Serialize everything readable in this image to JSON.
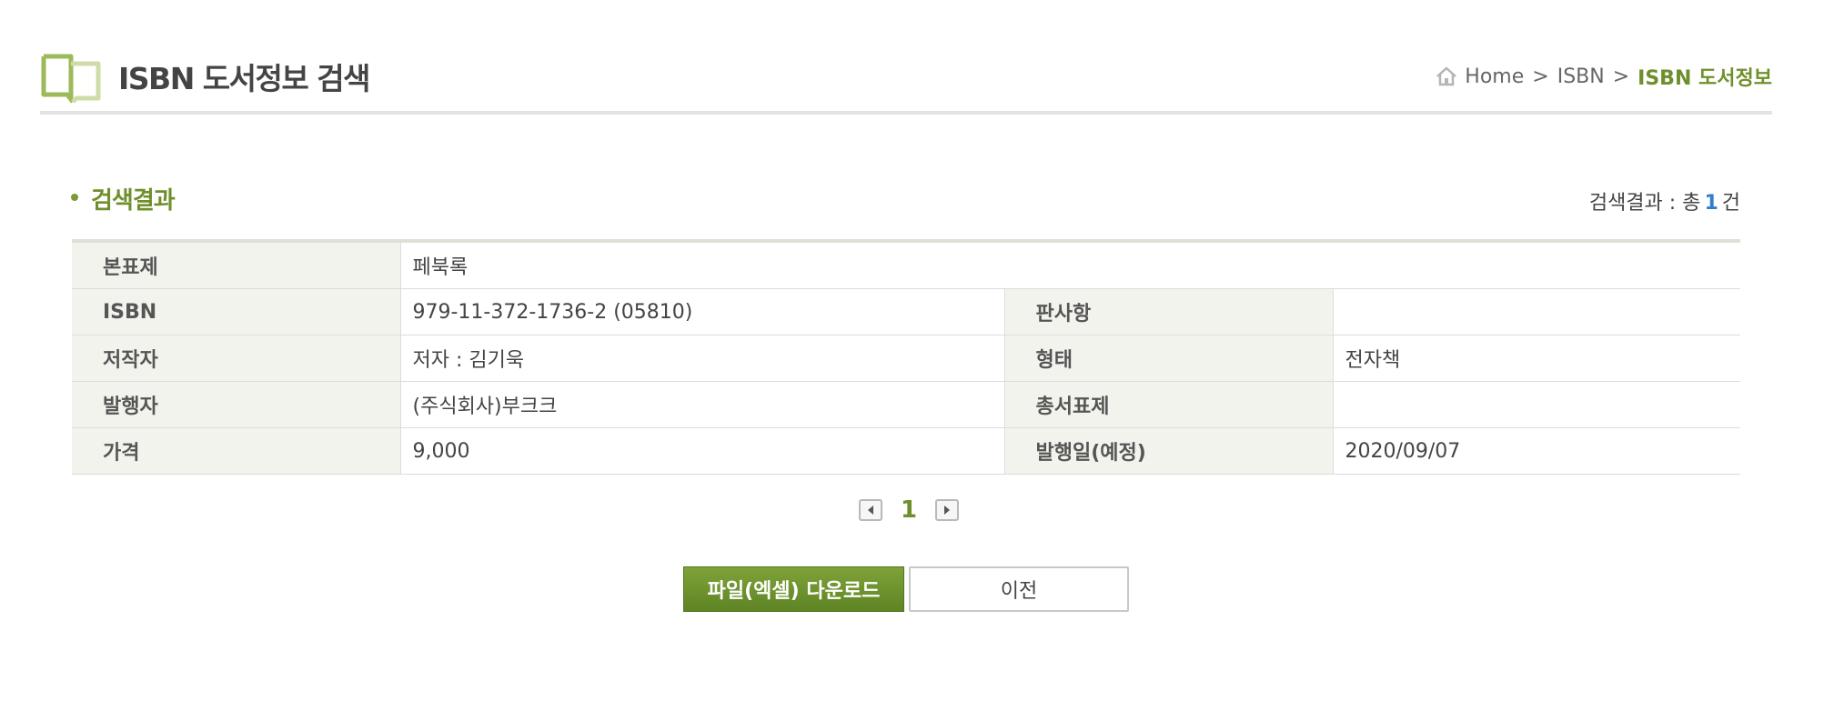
{
  "header": {
    "title": "ISBN 도서정보 검색",
    "breadcrumb": {
      "home": "Home",
      "separator": ">",
      "middle": "ISBN",
      "current": "ISBN 도서정보"
    }
  },
  "icons": {
    "book": "book-outline-icon",
    "home": "home-icon",
    "prev_page": "caret-left-icon",
    "next_page": "caret-right-icon"
  },
  "colors": {
    "accent_green": "#6f8f2c",
    "count_blue": "#2f7fd1",
    "label_bg": "#f3f3ee"
  },
  "section": {
    "title": "검색결과",
    "count_prefix": "검색결과 : 총",
    "count_value": "1",
    "count_suffix": "건"
  },
  "book": {
    "title_label": "본표제",
    "title_value": "페북록",
    "isbn_label": "ISBN",
    "isbn_value": "979-11-372-1736-2 (05810)",
    "edition_label": "판사항",
    "edition_value": "",
    "author_label": "저작자",
    "author_value": "저자 : 김기욱",
    "format_label": "형태",
    "format_value": "전자책",
    "publisher_label": "발행자",
    "publisher_value": "(주식회사)부크크",
    "series_label": "총서표제",
    "series_value": "",
    "price_label": "가격",
    "price_value": "9,000",
    "pubdate_label": "발행일(예정)",
    "pubdate_value": "2020/09/07"
  },
  "pagination": {
    "current_page": "1"
  },
  "buttons": {
    "download_label": "파일(엑셀) 다운로드",
    "prev_label": "이전"
  }
}
